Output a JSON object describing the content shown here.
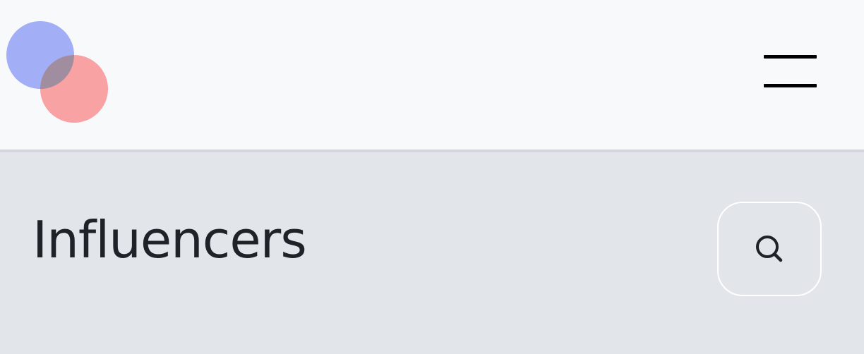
{
  "header": {
    "logo": {
      "circle_colors": [
        "#a2aef5",
        "#f8a2a4"
      ],
      "overlap_color": "#a08d9f"
    },
    "menu_icon": "hamburger-icon"
  },
  "main": {
    "title": "Influencers",
    "search_icon": "search-icon"
  },
  "colors": {
    "header_bg": "#f8f9fb",
    "main_bg": "#e2e5ea",
    "title_text": "#1f2228"
  }
}
